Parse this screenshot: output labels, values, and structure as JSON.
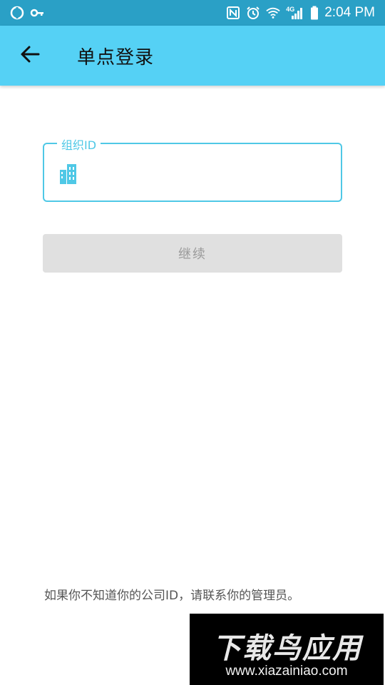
{
  "status_bar": {
    "time": "2:04 PM",
    "network": "4G",
    "icons": [
      "sync-icon",
      "key-icon",
      "nfc-icon",
      "alarm-icon",
      "wifi-icon",
      "signal-icon",
      "battery-icon"
    ]
  },
  "app_bar": {
    "title": "单点登录",
    "back_icon": "arrow-left-icon",
    "background": "#55d1f5"
  },
  "form": {
    "org_id": {
      "label": "组织ID",
      "value": "",
      "icon": "building-icon",
      "accent": "#4fc8e6"
    },
    "continue_label": "继续"
  },
  "hint_text": "如果你不知道你的公司ID，请联系你的管理员。",
  "watermark": {
    "title": "下载鸟应用",
    "url": "www.xiazainiao.com"
  }
}
